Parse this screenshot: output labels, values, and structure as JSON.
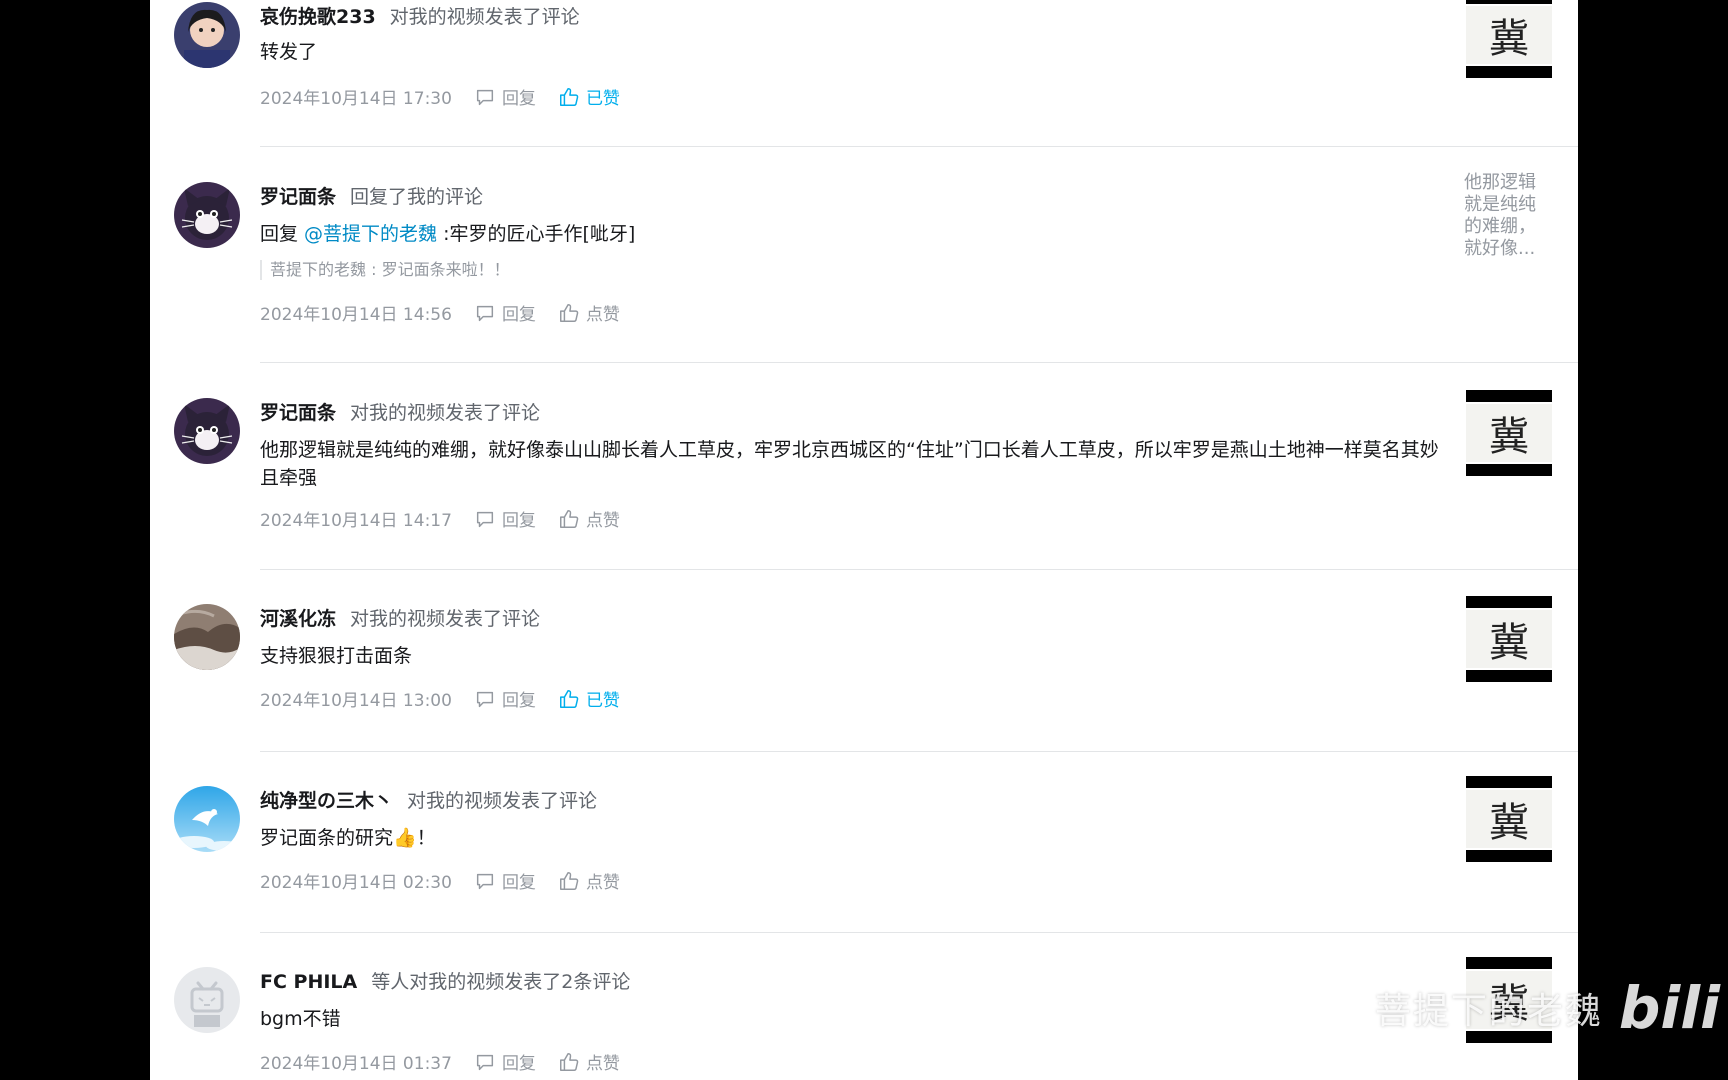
{
  "comments": [
    {
      "username": "哀伤挽歌233",
      "action": "对我的视频发表了评论",
      "content": "转发了",
      "time": "2024年10月14日 17:30",
      "reply_label": "回复",
      "like_label": "已赞",
      "liked": true,
      "avatar": "girl-photo-avatar",
      "thumbnail": "冀"
    },
    {
      "username": "罗记面条",
      "action": "回复了我的评论",
      "content_prefix": "回复 ",
      "mention": "@菩提下的老魏",
      "content": " :牢罗的匠心手作[呲牙]",
      "quote": "菩提下的老魏 : 罗记面条来啦！！",
      "time": "2024年10月14日 14:56",
      "reply_label": "回复",
      "like_label": "点赞",
      "liked": false,
      "avatar": "cartoon-cat-avatar",
      "thumbnail_text": "他那逻辑就是纯纯的难绷，就好像..."
    },
    {
      "username": "罗记面条",
      "action": "对我的视频发表了评论",
      "content": "他那逻辑就是纯纯的难绷，就好像泰山山脚长着人工草皮，牢罗北京西城区的“住址”门口长着人工草皮，所以牢罗是燕山土地神一样莫名其妙且牵强",
      "time": "2024年10月14日 14:17",
      "reply_label": "回复",
      "like_label": "点赞",
      "liked": false,
      "avatar": "cartoon-cat-avatar",
      "thumbnail": "冀"
    },
    {
      "username": "河溪化冻",
      "action": "对我的视频发表了评论",
      "content": "支持狠狠打击面条",
      "time": "2024年10月14日 13:00",
      "reply_label": "回复",
      "like_label": "已赞",
      "liked": true,
      "avatar": "landscape-photo-avatar",
      "thumbnail": "冀"
    },
    {
      "username": "纯净型の三木丶",
      "action": "对我的视频发表了评论",
      "content": "罗记面条的研究👍！",
      "time": "2024年10月14日 02:30",
      "reply_label": "回复",
      "like_label": "点赞",
      "liked": false,
      "avatar": "sky-bird-avatar",
      "thumbnail": "冀"
    },
    {
      "username": "FC PHILA",
      "action": "等人对我的视频发表了2条评论",
      "content": "bgm不错",
      "time": "2024年10月14日 01:37",
      "reply_label": "回复",
      "like_label": "点赞",
      "liked": false,
      "avatar": "default-tv-avatar",
      "thumbnail": "冀"
    }
  ],
  "watermark": {
    "text": "菩提下的老魏",
    "logo": "bili"
  },
  "colors": {
    "liked": "#00aeec",
    "mention": "#008ac5",
    "meta": "#9499a0"
  }
}
